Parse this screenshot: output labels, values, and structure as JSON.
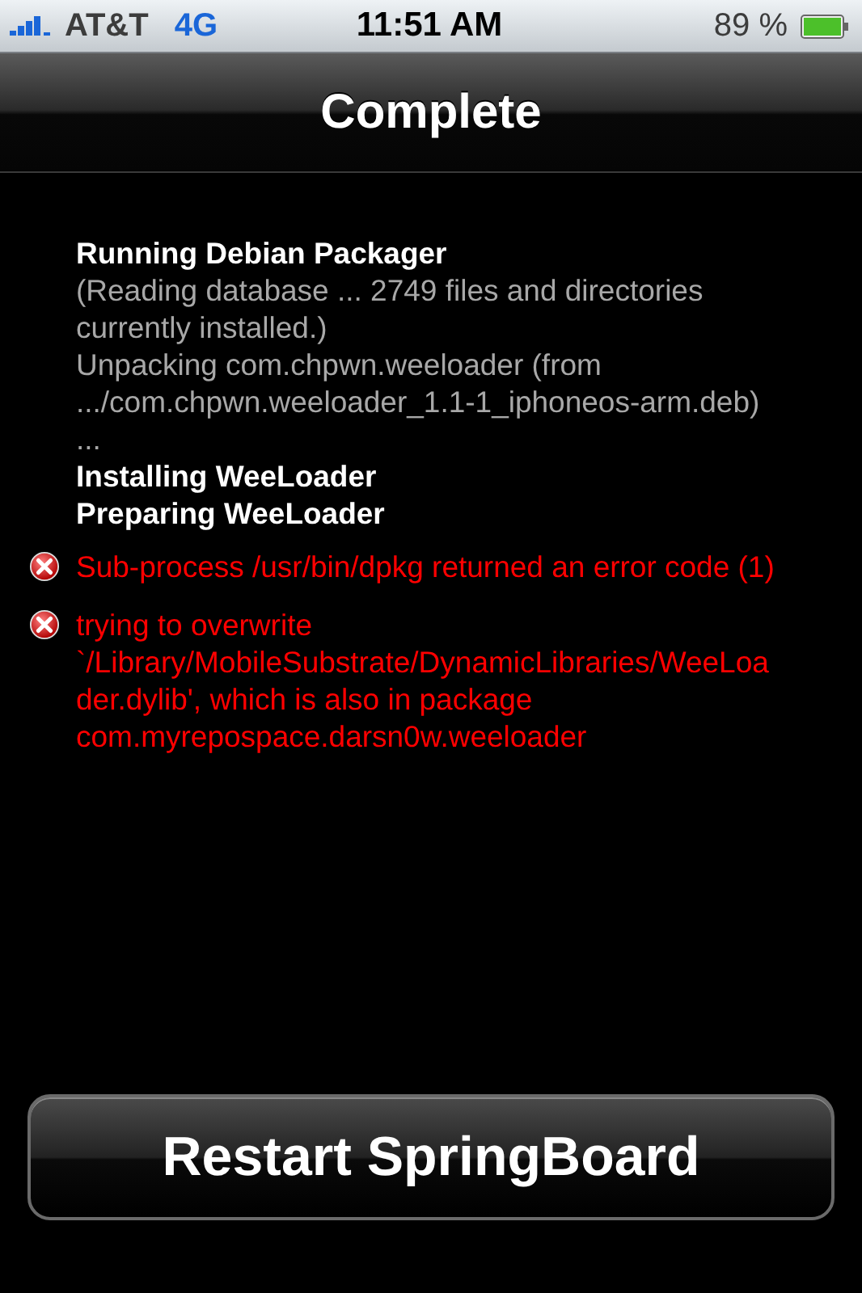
{
  "status_bar": {
    "carrier": "AT&T",
    "network": "4G",
    "time": "11:51 AM",
    "battery": "89 %"
  },
  "nav_bar": {
    "title": "Complete"
  },
  "log": [
    {
      "kind": "heading",
      "lines": [
        "Running Debian Packager"
      ]
    },
    {
      "kind": "output",
      "lines": [
        "(Reading database ... 2749 files and directories",
        "currently installed.)"
      ]
    },
    {
      "kind": "output",
      "lines": [
        "Unpacking com.chpwn.weeloader (from",
        ".../com.chpwn.weeloader_1.1-1_iphoneos-arm.deb)",
        "..."
      ]
    },
    {
      "kind": "heading",
      "lines": [
        "Installing WeeLoader"
      ]
    },
    {
      "kind": "heading",
      "lines": [
        "Preparing WeeLoader"
      ]
    },
    {
      "kind": "error",
      "lines": [
        "Sub-process /usr/bin/dpkg returned an error code (1)"
      ]
    },
    {
      "kind": "error",
      "lines": [
        "trying to overwrite",
        "`/Library/MobileSubstrate/DynamicLibraries/WeeLoa",
        "der.dylib', which is also in package",
        "com.myrepospace.darsn0w.weeloader"
      ]
    }
  ],
  "button": {
    "label": "Restart SpringBoard"
  }
}
